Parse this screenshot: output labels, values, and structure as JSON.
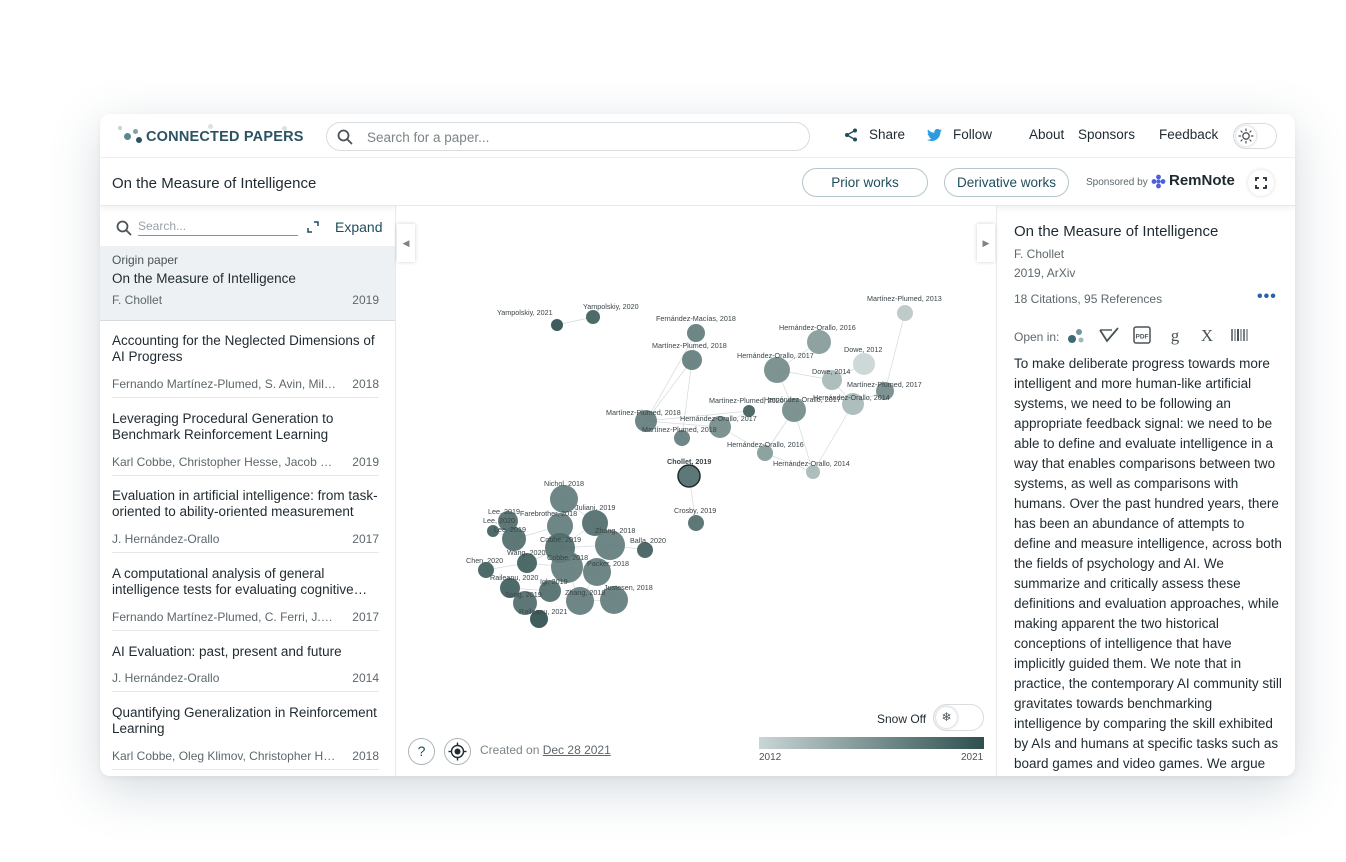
{
  "header": {
    "logo_text": "CONNECTED PAPERS",
    "search_placeholder": "Search for a paper...",
    "nav": {
      "share": "Share",
      "follow": "Follow",
      "about": "About",
      "sponsors": "Sponsors",
      "feedback": "Feedback"
    }
  },
  "titlebar": {
    "title": "On the Measure of Intelligence",
    "prior_works": "Prior works",
    "derivative_works": "Derivative works",
    "sponsored_by": "Sponsored by",
    "sponsor_name": "RemNote"
  },
  "list": {
    "search_placeholder": "Search...",
    "expand_label": "Expand",
    "origin": {
      "label": "Origin paper",
      "title": "On the Measure of Intelligence",
      "authors": "F. Chollet",
      "year": "2019"
    },
    "items": [
      {
        "title": "Accounting for the Neglected Dimensions of AI Progress",
        "authors": "Fernando Martínez-Plumed, S. Avin, Miles…",
        "year": "2018"
      },
      {
        "title": "Leveraging Procedural Generation to Benchmark Reinforcement Learning",
        "authors": "Karl Cobbe, Christopher Hesse, Jacob Hilton,…",
        "year": "2019"
      },
      {
        "title": "Evaluation in artificial intelligence: from task-oriented to ability-oriented measurement",
        "authors": "J. Hernández-Orallo",
        "year": "2017"
      },
      {
        "title": "A computational analysis of general intelligence tests for evaluating cognitive…",
        "authors": "Fernando Martínez-Plumed, C. Ferri, J.…",
        "year": "2017"
      },
      {
        "title": "AI Evaluation: past, present and future",
        "authors": "J. Hernández-Orallo",
        "year": "2014"
      },
      {
        "title": "Quantifying Generalization in Reinforcement Learning",
        "authors": "Karl Cobbe, Oleg Klimov, Christopher Hesse,…",
        "year": "2018"
      }
    ]
  },
  "graph": {
    "colors": {
      "old": "#c9d6d5",
      "new": "#2e4f4e"
    },
    "nodes": [
      {
        "label": "Yampolskiy, 2020",
        "year": 2020,
        "r": 7
      },
      {
        "label": "Yampolskiy, 2021",
        "year": 2021,
        "r": 6
      },
      {
        "label": "Fernández-Macías, 2018",
        "year": 2018,
        "r": 9
      },
      {
        "label": "Martínez-Plumed, 2013",
        "year": 2013,
        "r": 8
      },
      {
        "label": "Hernández-Orallo, 2016",
        "year": 2016,
        "r": 12
      },
      {
        "label": "Martínez-Plumed, 2018",
        "year": 2018,
        "r": 10
      },
      {
        "label": "Hernández-Orallo, 2017",
        "year": 2017,
        "r": 13
      },
      {
        "label": "Dowe, 2012",
        "year": 2012,
        "r": 11
      },
      {
        "label": "Dowe, 2014",
        "year": 2014,
        "r": 10
      },
      {
        "label": "Martínez-Plumed, 2017",
        "year": 2017,
        "r": 9
      },
      {
        "label": "Hernández-Orallo, 2014",
        "year": 2014,
        "r": 11
      },
      {
        "label": "Martínez-Plumed, 2020",
        "year": 2020,
        "r": 6
      },
      {
        "label": "Hernández-Orallo, 2017",
        "year": 2017,
        "r": 12
      },
      {
        "label": "Martínez-Plumed, 2018",
        "year": 2018,
        "r": 11
      },
      {
        "label": "Hernández-Orallo, 2017",
        "year": 2017,
        "r": 11
      },
      {
        "label": "Martínez-Plumed, 2018",
        "year": 2018,
        "r": 8
      },
      {
        "label": "Hernández-Orallo, 2016",
        "year": 2016,
        "r": 8
      },
      {
        "label": "Hernández-Orallo, 2014",
        "year": 2014,
        "r": 7
      },
      {
        "label": "Chollet, 2019",
        "year": 2019,
        "r": 11,
        "origin": true
      },
      {
        "label": "Crosby, 2019",
        "year": 2019,
        "r": 8
      },
      {
        "label": "Nichol, 2018",
        "year": 2018,
        "r": 14
      },
      {
        "label": "Juliani, 2019",
        "year": 2019,
        "r": 13
      },
      {
        "label": "Farebrother, 2018",
        "year": 2018,
        "r": 13
      },
      {
        "label": "Lee, 2019",
        "year": 2019,
        "r": 10
      },
      {
        "label": "Lee, 2020",
        "year": 2020,
        "r": 6
      },
      {
        "label": "Lee, 2019",
        "year": 2019,
        "r": 12
      },
      {
        "label": "Cobbe, 2019",
        "year": 2019,
        "r": 15
      },
      {
        "label": "Zhang, 2018",
        "year": 2018,
        "r": 15
      },
      {
        "label": "Balla, 2020",
        "year": 2020,
        "r": 8
      },
      {
        "label": "Wang, 2020",
        "year": 2020,
        "r": 10
      },
      {
        "label": "Cobbe, 2018",
        "year": 2018,
        "r": 16
      },
      {
        "label": "Packer, 2018",
        "year": 2018,
        "r": 14
      },
      {
        "label": "Chen, 2020",
        "year": 2020,
        "r": 8
      },
      {
        "label": "Raileanu, 2020",
        "year": 2020,
        "r": 10
      },
      {
        "label": "Igl, 2019",
        "year": 2019,
        "r": 11
      },
      {
        "label": "Song, 2019",
        "year": 2019,
        "r": 12
      },
      {
        "label": "Zhang, 2018",
        "year": 2018,
        "r": 14
      },
      {
        "label": "Justesen, 2018",
        "year": 2018,
        "r": 14
      },
      {
        "label": "Raileanu, 2021",
        "year": 2021,
        "r": 9
      }
    ],
    "created_prefix": "Created on",
    "created_date": "Dec 28 2021",
    "snow_label": "Snow Off",
    "colorbar_min": "2012",
    "colorbar_max": "2021"
  },
  "details": {
    "title": "On the Measure of Intelligence",
    "authors": "F. Chollet",
    "venue": "2019, ArXiv",
    "citations": "18 Citations, 95 References",
    "open_in": "Open in:",
    "open_icons": [
      "connected-papers-icon",
      "semantic-scholar-icon",
      "pdf-icon",
      "google-scholar-icon",
      "x-icon",
      "barcode-icon"
    ],
    "abstract": "To make deliberate progress towards more intelligent and more human-like artificial systems, we need to be following an appropriate feedback signal: we need to be able to define and evaluate intelligence in a way that enables comparisons between two systems, as well as comparisons with humans. Over the past hundred years, there has been an abundance of attempts to define and measure intelligence, across both the fields of psychology and AI. We summarize and critically assess these definitions and evaluation approaches, while making apparent the two historical conceptions of intelligence that have implicitly guided them. We note that in practice, the contemporary AI community still gravitates towards benchmarking intelligence by comparing the skill exhibited by AIs and humans at specific tasks such as board games and video games. We argue"
  }
}
